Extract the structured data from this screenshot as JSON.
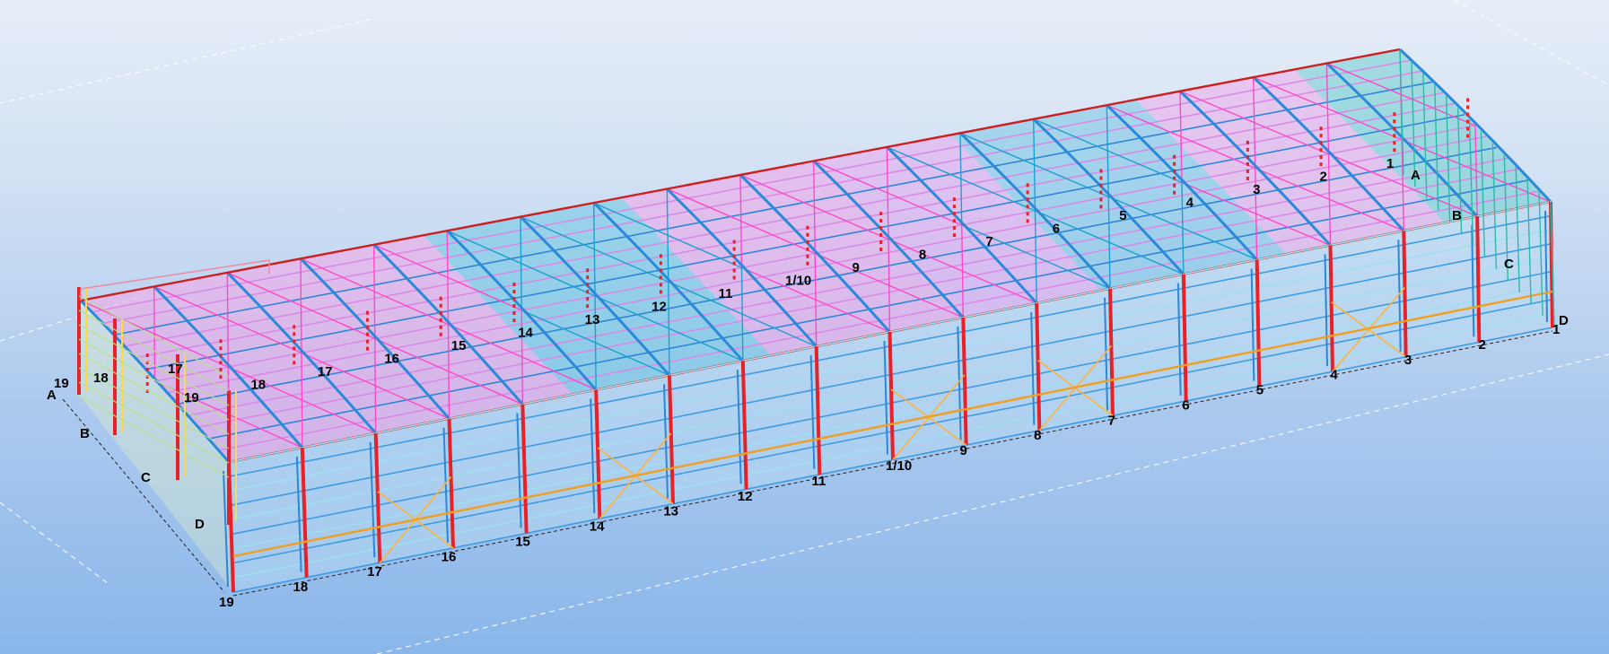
{
  "view": {
    "background_top": "#e7eef8",
    "background_bottom": "#8ab6ea"
  },
  "colors": {
    "column": "#e8202a",
    "purlin": "#3b8fe0",
    "roof_bracing": "#ff48c8",
    "roof_panel": "#3db8d0",
    "girt": "#ffd84a",
    "wall_brace": "#ffb23a",
    "eave": "#cc2020",
    "door_frame": "#f0a020"
  },
  "grid_rows": [
    "A",
    "B",
    "C",
    "D"
  ],
  "roof_labels": [
    "1",
    "2",
    "3",
    "4",
    "5",
    "6",
    "7",
    "8",
    "9",
    "1/10",
    "11",
    "12",
    "13",
    "14",
    "15",
    "16",
    "17",
    "18",
    "19"
  ],
  "front_labels": [
    "1",
    "2",
    "3",
    "4",
    "5",
    "6",
    "7",
    "8",
    "9",
    "1/10",
    "11",
    "12",
    "13",
    "14",
    "15",
    "16",
    "17",
    "18",
    "19"
  ],
  "labels": {
    "A": "A",
    "B": "B",
    "C": "C",
    "D": "D",
    "A_right": "A",
    "B_right": "B",
    "C_right": "C",
    "D_right": "D",
    "g19_left": "19",
    "g18_left": "18",
    "g17_left": "17"
  }
}
